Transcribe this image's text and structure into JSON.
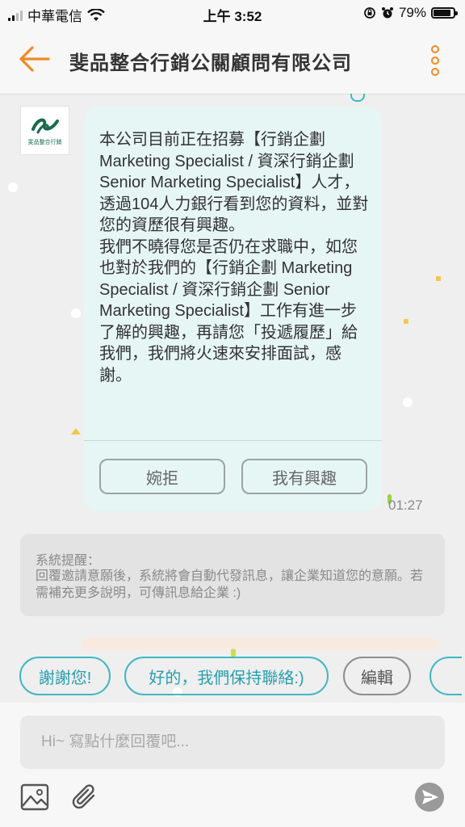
{
  "status_bar": {
    "carrier": "中華電信",
    "time": "上午 3:52",
    "battery": "79%"
  },
  "header": {
    "title": "斐品整合行銷公關顧問有限公司"
  },
  "company": {
    "logo_caption": "斐品整合行銷"
  },
  "message": {
    "text": "本公司目前正在招募【行銷企劃 Marketing Specialist / 資深行銷企劃 Senior Marketing Specialist】人才，\n透過104人力銀行看到您的資料，並對您的資歷很有興趣。\n我們不曉得您是否仍在求職中，如您也對於我們的【行銷企劃 Marketing Specialist / 資深行銷企劃 Senior Marketing Specialist】工作有進一步了解的興趣，再請您「投遞履歷」給我們，我們將火速來安排面試，感謝。",
    "decline_label": "婉拒",
    "interest_label": "我有興趣",
    "time": "01:27"
  },
  "system_notice": {
    "title": "系統提醒：",
    "body": "回覆邀請意願後，系統將會自動代發訊息，讓企業知道您的意願。若需補充更多說明，可傳訊息給企業 :)"
  },
  "quick_replies": {
    "items": [
      "謝謝您!",
      "好的，我們保持聯絡:)"
    ],
    "edit_label": "編輯"
  },
  "composer": {
    "placeholder": "Hi~ 寫點什麼回覆吧..."
  },
  "colors": {
    "accent_orange": "#f08a24",
    "chip_teal": "#40b7c4",
    "bubble_bg": "#e6f6f4"
  }
}
